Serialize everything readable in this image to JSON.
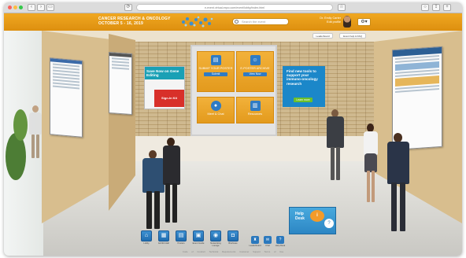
{
  "browser": {
    "url": "e-event.virtual-expo.com/event/lobby/index.html",
    "window_controls": [
      "close",
      "minimize",
      "maximize"
    ],
    "window_colors": [
      "#fc605c",
      "#fdbc40",
      "#34c84a"
    ]
  },
  "header": {
    "title_line1": "CANCER RESEARCH & ONCOLOGY",
    "title_line2": "OCTOBER 5 - 16, 2019",
    "search_placeholder": "Search the event",
    "user_name": "Dr. Emily Carter",
    "user_status": "Edit profile",
    "settings_icon": "gear-icon",
    "accent": "#e8991a"
  },
  "subheader": {
    "left_label": "Leaderboard",
    "right_label": "Event help & FAQ"
  },
  "kiosk": {
    "tiles": [
      {
        "icon": "doc-icon",
        "title": "SUBMIT YOUR POSTER",
        "button": "Submit"
      },
      {
        "icon": "user-icon",
        "title": "E-POSTER ARCHIVE",
        "button": "View Now"
      },
      {
        "icon": "chat-icon",
        "title": "Meet & Chat",
        "button": ""
      },
      {
        "icon": "book-icon",
        "title": "Resources",
        "button": ""
      }
    ]
  },
  "ads": {
    "left_title": "Save Now on Gene Editing",
    "left_banner": "Sign-In Kit",
    "right_title": "Find new tools to support your immuno-oncology research",
    "right_button": "Learn more"
  },
  "help_desk": {
    "label_line1": "Help",
    "label_line2": "Desk",
    "badge": "i"
  },
  "nav": {
    "items": [
      {
        "icon": "home-icon",
        "label": "Lobby"
      },
      {
        "icon": "exhibit-icon",
        "label": "Exhibit Hall"
      },
      {
        "icon": "poster-icon",
        "label": "Posters"
      },
      {
        "icon": "calendar-icon",
        "label": "Event Guide"
      },
      {
        "icon": "networking-icon",
        "label": "Networking Lounge"
      },
      {
        "icon": "bag-icon",
        "label": "Briefcase"
      }
    ],
    "utilities": [
      {
        "icon": "trophy-icon",
        "label": "Leaderboard"
      },
      {
        "icon": "chat-bubble-icon",
        "label": "Chat"
      },
      {
        "icon": "help-icon",
        "label": "Help Desk"
      }
    ]
  },
  "footer": {
    "links": [
      "Code of Conduct",
      "Technical Requirements",
      "Customer Support",
      "Terms of Use"
    ]
  }
}
